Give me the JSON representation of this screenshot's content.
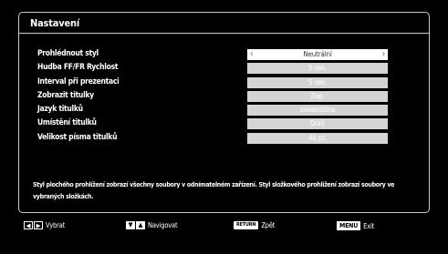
{
  "window": {
    "title": "Nastavení"
  },
  "settings": [
    {
      "label": "Prohlédnout styl",
      "value": "Neutrální",
      "selected": true
    },
    {
      "label": "Hudba FF/FR Rychlost",
      "value": "5 sek."
    },
    {
      "label": "Interval při prezentaci",
      "value": "5 sek."
    },
    {
      "label": "Zobrazit titulky",
      "value": "Zap."
    },
    {
      "label": "Jazyk titulků",
      "value": "slovenština"
    },
    {
      "label": "Umístění titulků",
      "value": "Dolů"
    },
    {
      "label": "Velikost písma titulků",
      "value": "46 pt."
    }
  ],
  "description": "Styl plochého prohlížení zobrazí všechny soubory v odnímatelném zařízení.  Styl složkového prohlížení zobrazí soubory ve vybraných složkách.",
  "footer": {
    "select_label": "Vybrat",
    "navigate_label": "Navigovat",
    "return_key": "RETURN",
    "back_label": "Zpět",
    "menu_key": "MENU",
    "exit_label": "Exit"
  }
}
